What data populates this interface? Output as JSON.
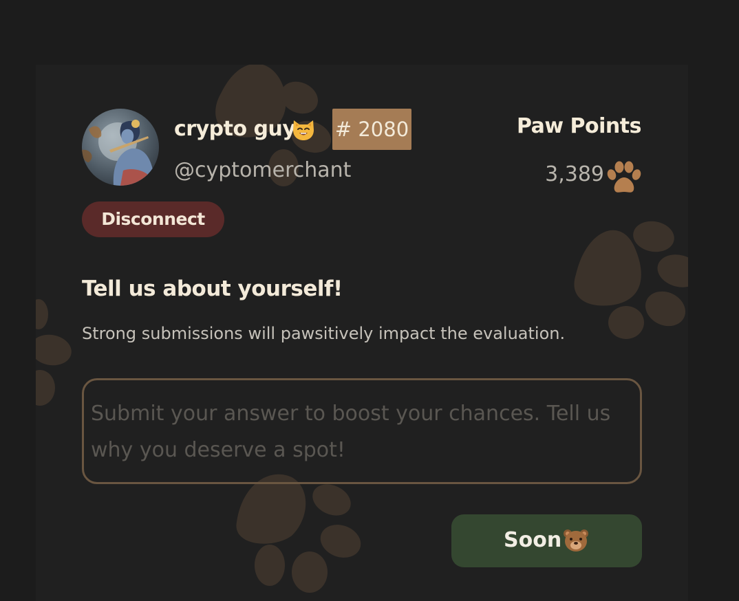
{
  "profile": {
    "display_name": "crypto guy",
    "display_name_emoji": "smiling-cat-emoji",
    "rank": "# 2080",
    "handle": "@cyptomerchant",
    "avatar": "profile-avatar-illustration"
  },
  "points": {
    "label": "Paw Points",
    "value": "3,389",
    "icon": "paw-icon",
    "icon_color": "#b57f4f"
  },
  "actions": {
    "disconnect_label": "Disconnect"
  },
  "questionnaire": {
    "title": "Tell us about yourself!",
    "subtitle": "Strong submissions will pawsitively impact the evaluation.",
    "answer_value": "",
    "answer_placeholder": "Submit your answer to boost your chances. Tell us why you deserve a spot!",
    "submit_label": "Soon",
    "submit_emoji": "bear-face-emoji"
  },
  "colors": {
    "background": "#1c1c1c",
    "card": "#202020",
    "rank_badge": "#a57c55",
    "disconnect": "#5a2a29",
    "submit": "#344730",
    "input_border": "#6a5641",
    "paw_watermark": "#3b322a"
  }
}
